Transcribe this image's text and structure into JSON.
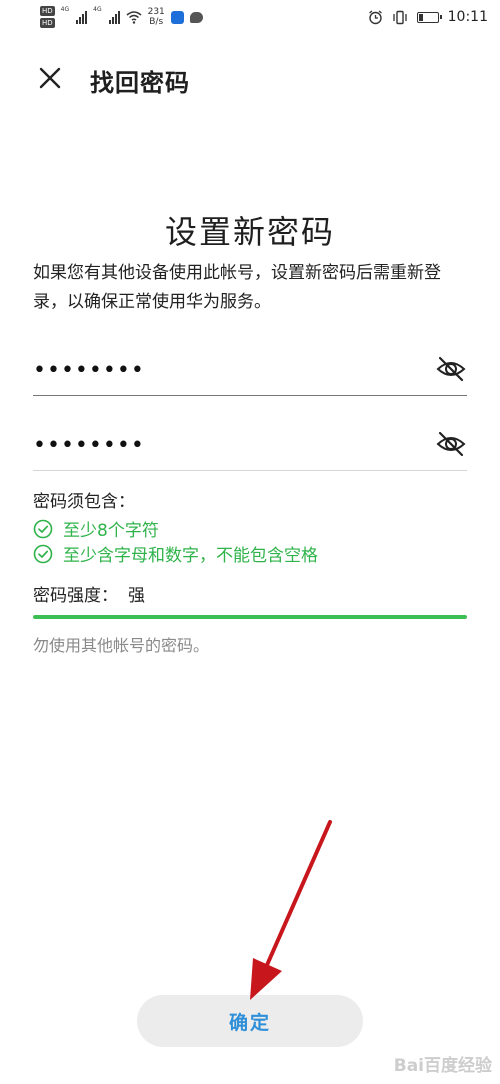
{
  "status_bar": {
    "network_left": "4G",
    "network_right": "4G",
    "speed_value": "231",
    "speed_unit": "B/s",
    "time": "10:11"
  },
  "header": {
    "close_icon": "close-icon",
    "title": "找回密码"
  },
  "main": {
    "heading": "设置新密码",
    "description": "如果您有其他设备使用此帐号，设置新密码后需重新登录，以确保正常使用华为服务。",
    "password_field": {
      "value": "••••••••",
      "icon": "eye-slash-icon"
    },
    "confirm_password_field": {
      "value": "••••••••",
      "icon": "eye-slash-icon"
    },
    "rules_title": "密码须包含：",
    "rules": [
      {
        "text": "至少8个字符",
        "icon": "check-circle-icon"
      },
      {
        "text": "至少含字母和数字，不能包含空格",
        "icon": "check-circle-icon"
      }
    ],
    "strength_label": "密码强度：",
    "strength_value": "强",
    "strength_level": 1.0,
    "hint": "勿使用其他帐号的密码。"
  },
  "footer": {
    "confirm_label": "确定"
  },
  "watermark": "Bai百度经验",
  "colors": {
    "accent_green": "#2fb34a",
    "button_text_blue": "#2f8fd8",
    "annotation_arrow_red": "#c8161d"
  }
}
